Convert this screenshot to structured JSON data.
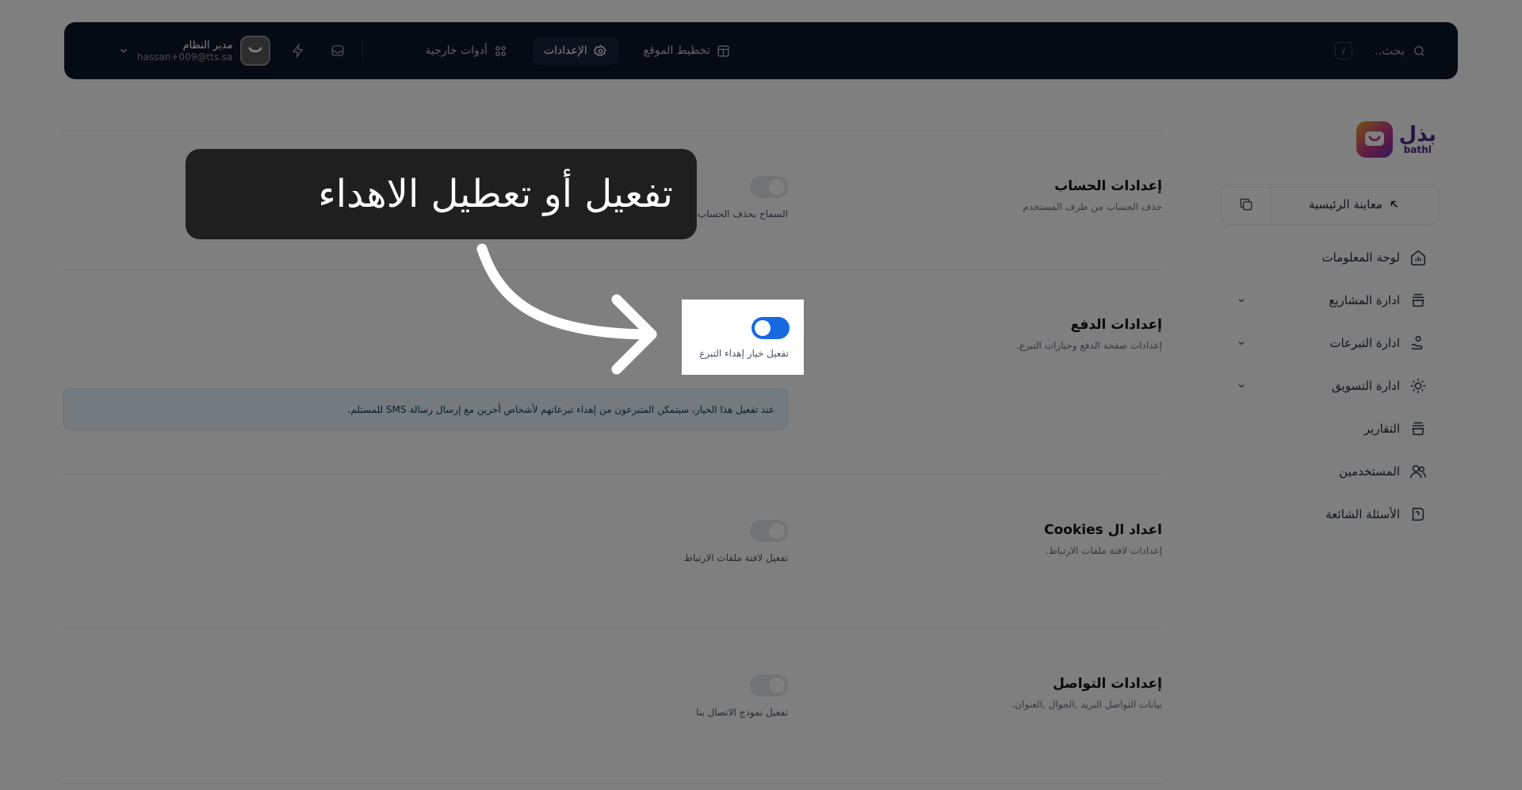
{
  "topbar": {
    "search_placeholder": "بحث..",
    "search_shortcut": "/",
    "nav": [
      {
        "label": "تخطيط الموقع",
        "icon": "layout-icon"
      },
      {
        "label": "الإعدادات",
        "icon": "gear-icon",
        "active": true
      },
      {
        "label": "أدوات خارجية",
        "icon": "apps-icon"
      }
    ],
    "user": {
      "name": "مدير النظام",
      "email": "hassan+009@tts.sa"
    }
  },
  "logo": {
    "arabic": "بذل",
    "latin": "bathl"
  },
  "sidebar": {
    "preview_label": "معاينة الرئيسية",
    "items": [
      {
        "label": "لوحة المعلومات",
        "icon": "dashboard-icon",
        "has_children": false
      },
      {
        "label": "ادارة المشاريع",
        "icon": "projects-icon",
        "has_children": true
      },
      {
        "label": "ادارة التبرعات",
        "icon": "donations-icon",
        "has_children": true
      },
      {
        "label": "ادارة التسويق",
        "icon": "marketing-icon",
        "has_children": true
      },
      {
        "label": "التقارير",
        "icon": "reports-icon",
        "has_children": false
      },
      {
        "label": "المستخدمين",
        "icon": "users-icon",
        "has_children": false
      },
      {
        "label": "الأسئلة الشائعة",
        "icon": "faq-icon",
        "has_children": false
      }
    ]
  },
  "settings": {
    "account": {
      "title": "إعدادات الحساب",
      "desc": "حذف الحساب من طرف المستخدم",
      "toggle_label": "السماح بحذف الحساب من طرف المستخدم",
      "enabled": false
    },
    "payment": {
      "title": "إعدادات الدفع",
      "desc": "إعدادات صفحة الدفع وخيارات التبرع.",
      "toggle_label": "تفعيل خيار إهداء التبرع",
      "enabled": true,
      "info": "عند تفعيل هذا الخيار، سيتمكن المتبرعون من إهداء تبرعاتهم لأشخاص أخرين مع إرسال رسالة SMS للمستلم."
    },
    "cookies": {
      "title": "اعداد ال Cookies",
      "desc": "إعدادات لافتة ملفات الارتباط.",
      "toggle_label": "تفعيل لافتة ملفات الارتباط",
      "enabled": false
    },
    "contact": {
      "title": "إعدادات التواصل",
      "desc": "بيانات التواصل البريد ,الجوال ,العنوان.",
      "toggle_label": "تفعيل نموذج الاتصال بنا",
      "enabled": false
    }
  },
  "callout": {
    "text": "تفعيل أو تعطيل الاهداء"
  },
  "colors": {
    "topbar": "#0a1628",
    "toggle_on": "#1769e0",
    "overlay": "rgba(0,0,0,0.5)"
  }
}
